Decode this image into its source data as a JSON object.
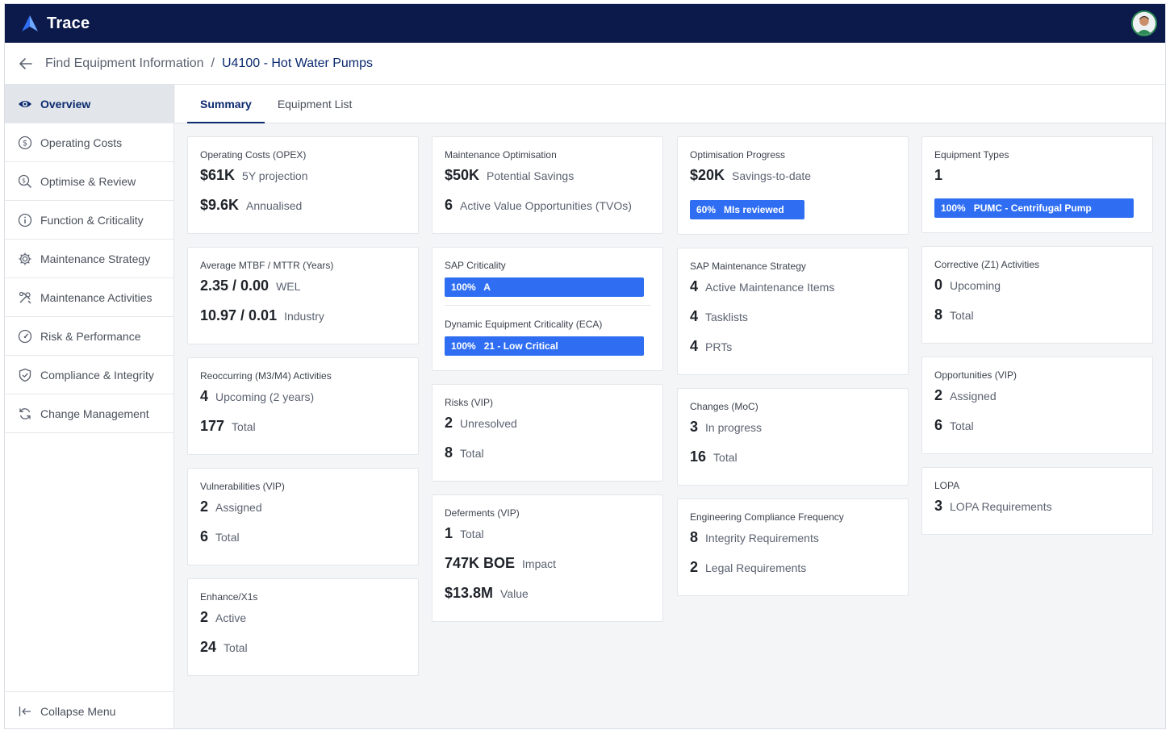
{
  "app": {
    "brand": "Trace"
  },
  "breadcrumb": {
    "parent": "Find Equipment Information",
    "separator": "/",
    "current": "U4100 - Hot Water Pumps"
  },
  "sidebar": {
    "items": [
      {
        "label": "Overview",
        "icon": "eye-icon",
        "active": true
      },
      {
        "label": "Operating Costs",
        "icon": "dollar-circle-icon"
      },
      {
        "label": "Optimise & Review",
        "icon": "search-dollar-icon"
      },
      {
        "label": "Function & Criticality",
        "icon": "info-circle-icon"
      },
      {
        "label": "Maintenance Strategy",
        "icon": "gear-icon"
      },
      {
        "label": "Maintenance Activities",
        "icon": "tools-icon"
      },
      {
        "label": "Risk & Performance",
        "icon": "gauge-icon"
      },
      {
        "label": "Compliance & Integrity",
        "icon": "shield-check-icon"
      },
      {
        "label": "Change Management",
        "icon": "refresh-icon"
      }
    ],
    "collapse_label": "Collapse Menu"
  },
  "tabs": [
    {
      "label": "Summary",
      "active": true
    },
    {
      "label": "Equipment List"
    }
  ],
  "colors": {
    "nav_bg": "#0b1a4a",
    "accent": "#2f6ef2",
    "active_text": "#0b2a6e"
  },
  "cards": {
    "opex": {
      "title": "Operating Costs (OPEX)",
      "rows": [
        {
          "num": "$61K",
          "label": "5Y projection"
        },
        {
          "num": "$9.6K",
          "label": "Annualised"
        }
      ]
    },
    "mtbf": {
      "title": "Average MTBF / MTTR (Years)",
      "rows": [
        {
          "num": "2.35 / 0.00",
          "label": "WEL"
        },
        {
          "num": "10.97 / 0.01",
          "label": "Industry"
        }
      ]
    },
    "reoccurring": {
      "title": "Reoccurring (M3/M4) Activities",
      "rows": [
        {
          "num": "4",
          "label": "Upcoming (2 years)"
        },
        {
          "num": "177",
          "label": "Total"
        }
      ]
    },
    "vulnerabilities": {
      "title": "Vulnerabilities (VIP)",
      "rows": [
        {
          "num": "2",
          "label": "Assigned"
        },
        {
          "num": "6",
          "label": "Total"
        }
      ]
    },
    "enhance": {
      "title": "Enhance/X1s",
      "rows": [
        {
          "num": "2",
          "label": "Active"
        },
        {
          "num": "24",
          "label": "Total"
        }
      ]
    },
    "maint_opt": {
      "title": "Maintenance Optimisation",
      "rows": [
        {
          "num": "$50K",
          "label": "Potential Savings"
        },
        {
          "num": "6",
          "label": "Active Value Opportunities (TVOs)"
        }
      ]
    },
    "sap_crit": {
      "title": "SAP Criticality",
      "bar_pct": "100%",
      "bar_label": "A",
      "bar_fill": 1.0,
      "eca_title": "Dynamic Equipment Criticality (ECA)",
      "eca_pct": "100%",
      "eca_label": "21 - Low Critical",
      "eca_fill": 1.0
    },
    "risks": {
      "title": "Risks (VIP)",
      "rows": [
        {
          "num": "2",
          "label": "Unresolved"
        },
        {
          "num": "8",
          "label": "Total"
        }
      ]
    },
    "deferments": {
      "title": "Deferments (VIP)",
      "rows": [
        {
          "num": "1",
          "label": "Total"
        },
        {
          "num": "747K BOE",
          "label": "Impact"
        },
        {
          "num": "$13.8M",
          "label": "Value"
        }
      ]
    },
    "opt_progress": {
      "title": "Optimisation Progress",
      "rows": [
        {
          "num": "$20K",
          "label": "Savings-to-date"
        }
      ],
      "bar_pct": "60%",
      "bar_label": "MIs reviewed",
      "bar_fill": 0.6
    },
    "sap_strategy": {
      "title": "SAP Maintenance Strategy",
      "rows": [
        {
          "num": "4",
          "label": "Active Maintenance Items"
        },
        {
          "num": "4",
          "label": "Tasklists"
        },
        {
          "num": "4",
          "label": "PRTs"
        }
      ]
    },
    "changes": {
      "title": "Changes (MoC)",
      "rows": [
        {
          "num": "3",
          "label": "In progress"
        },
        {
          "num": "16",
          "label": "Total"
        }
      ]
    },
    "eng_compliance": {
      "title": "Engineering Compliance Frequency",
      "rows": [
        {
          "num": "8",
          "label": "Integrity Requirements"
        },
        {
          "num": "2",
          "label": "Legal Requirements"
        }
      ]
    },
    "equip_types": {
      "title": "Equipment Types",
      "count": "1",
      "bar_pct": "100%",
      "bar_label": "PUMC - Centrifugal Pump",
      "bar_fill": 1.0
    },
    "corrective": {
      "title": "Corrective (Z1) Activities",
      "rows": [
        {
          "num": "0",
          "label": "Upcoming"
        },
        {
          "num": "8",
          "label": "Total"
        }
      ]
    },
    "opportunities": {
      "title": "Opportunities (VIP)",
      "rows": [
        {
          "num": "2",
          "label": "Assigned"
        },
        {
          "num": "6",
          "label": "Total"
        }
      ]
    },
    "lopa": {
      "title": "LOPA",
      "rows": [
        {
          "num": "3",
          "label": "LOPA Requirements"
        }
      ]
    }
  }
}
